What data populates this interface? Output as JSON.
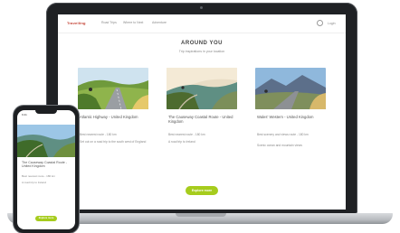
{
  "header": {
    "logo": "Travelling",
    "nav_items": [
      "Road Trips",
      "Where to Next",
      "Adventure"
    ],
    "account_label": "Login"
  },
  "main": {
    "title": "AROUND YOU",
    "subtitle": "Trip inspirations in your location",
    "cards": [
      {
        "title": "Atlantic Highway - United Kingdom",
        "lines": [
          "Best nearest route - 180 km",
          "Set out on a road trip to the south west of England"
        ]
      },
      {
        "title": "The Causeway Coastal Route - United Kingdom",
        "lines": [
          "Best nearest route - 180 km",
          "A road trip to Ireland"
        ]
      },
      {
        "title": "Wales' Western - United Kingdom",
        "lines": [
          "Best scenery and views route - 180 km",
          "Scenic ocean and mountain views"
        ]
      }
    ],
    "cta_label": "Explore more"
  },
  "phone": {
    "status_time": "9:41",
    "title": "The Causeway Coastal Route - United Kingdom",
    "lines": [
      "Best nearest route - 180 km",
      "A road trip to Ireland"
    ],
    "cta_label": "Explore more"
  },
  "colors": {
    "accent_green": "#a6cc1d",
    "brand_red": "#c0392b",
    "device_frame": "#1f2124"
  }
}
